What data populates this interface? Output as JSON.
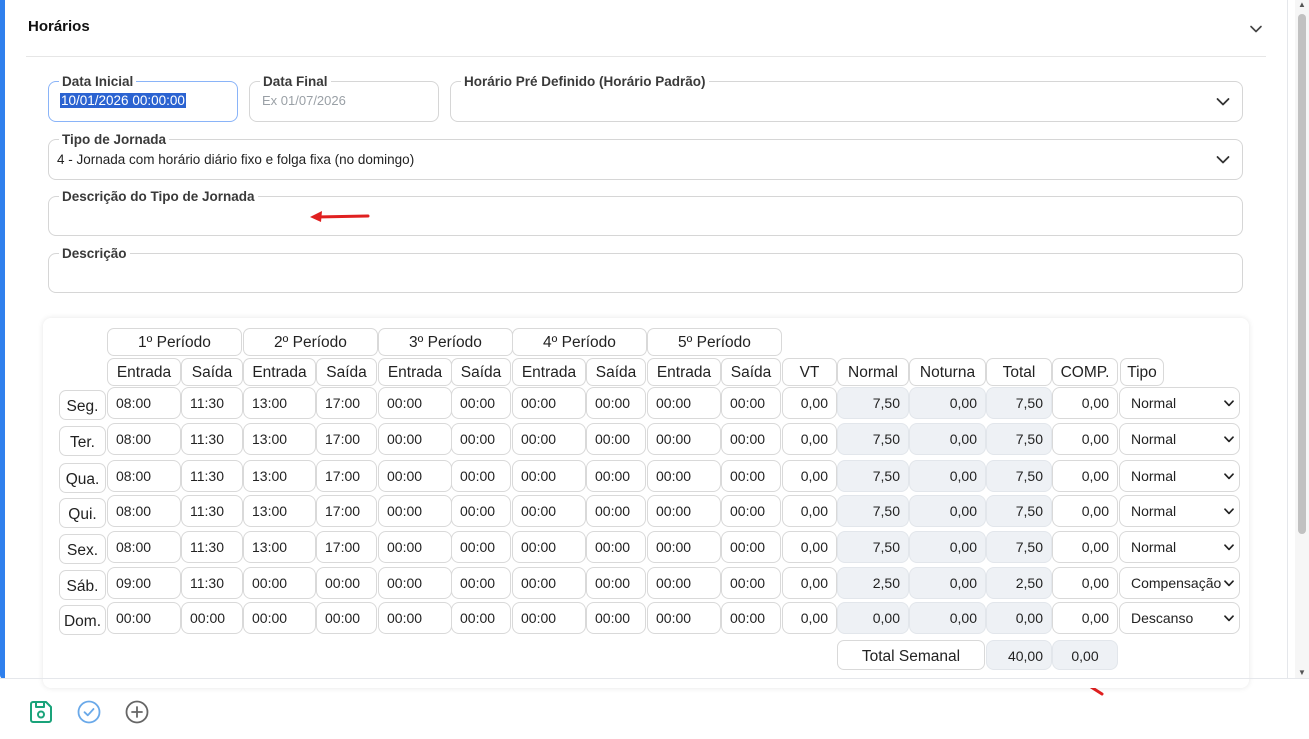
{
  "panel": {
    "title": "Horários"
  },
  "fields": {
    "data_inicial": {
      "label": "Data Inicial",
      "value": "10/01/2026 00:00:00"
    },
    "data_final": {
      "label": "Data Final",
      "placeholder": "Ex 01/07/2026"
    },
    "horario_pre": {
      "label": "Horário Pré Definido (Horário Padrão)",
      "value": ""
    },
    "tipo_jornada": {
      "label": "Tipo de Jornada",
      "value": "4 - Jornada com horário diário fixo e folga fixa (no domingo)"
    },
    "descricao_tipo": {
      "label": "Descrição do Tipo de Jornada",
      "value": ""
    },
    "descricao": {
      "label": "Descrição",
      "value": ""
    }
  },
  "schedule": {
    "periods": [
      "1º Período",
      "2º Período",
      "3º Período",
      "4º Período",
      "5º Período"
    ],
    "entrada_label": "Entrada",
    "saida_label": "Saída",
    "extra_headers": [
      "VT",
      "Normal",
      "Noturna",
      "Total",
      "COMP.",
      "Tipo"
    ],
    "rows": [
      {
        "day": "Seg.",
        "times": [
          "08:00",
          "11:30",
          "13:00",
          "17:00",
          "00:00",
          "00:00",
          "00:00",
          "00:00",
          "00:00",
          "00:00"
        ],
        "vt": "0,00",
        "normal": "7,50",
        "noturna": "0,00",
        "total": "7,50",
        "comp": "0,00",
        "tipo": "Normal"
      },
      {
        "day": "Ter.",
        "times": [
          "08:00",
          "11:30",
          "13:00",
          "17:00",
          "00:00",
          "00:00",
          "00:00",
          "00:00",
          "00:00",
          "00:00"
        ],
        "vt": "0,00",
        "normal": "7,50",
        "noturna": "0,00",
        "total": "7,50",
        "comp": "0,00",
        "tipo": "Normal"
      },
      {
        "day": "Qua.",
        "times": [
          "08:00",
          "11:30",
          "13:00",
          "17:00",
          "00:00",
          "00:00",
          "00:00",
          "00:00",
          "00:00",
          "00:00"
        ],
        "vt": "0,00",
        "normal": "7,50",
        "noturna": "0,00",
        "total": "7,50",
        "comp": "0,00",
        "tipo": "Normal"
      },
      {
        "day": "Qui.",
        "times": [
          "08:00",
          "11:30",
          "13:00",
          "17:00",
          "00:00",
          "00:00",
          "00:00",
          "00:00",
          "00:00",
          "00:00"
        ],
        "vt": "0,00",
        "normal": "7,50",
        "noturna": "0,00",
        "total": "7,50",
        "comp": "0,00",
        "tipo": "Normal"
      },
      {
        "day": "Sex.",
        "times": [
          "08:00",
          "11:30",
          "13:00",
          "17:00",
          "00:00",
          "00:00",
          "00:00",
          "00:00",
          "00:00",
          "00:00"
        ],
        "vt": "0,00",
        "normal": "7,50",
        "noturna": "0,00",
        "total": "7,50",
        "comp": "0,00",
        "tipo": "Normal"
      },
      {
        "day": "Sáb.",
        "times": [
          "09:00",
          "11:30",
          "00:00",
          "00:00",
          "00:00",
          "00:00",
          "00:00",
          "00:00",
          "00:00",
          "00:00"
        ],
        "vt": "0,00",
        "normal": "2,50",
        "noturna": "0,00",
        "total": "2,50",
        "comp": "0,00",
        "tipo": "Compensação"
      },
      {
        "day": "Dom.",
        "times": [
          "00:00",
          "00:00",
          "00:00",
          "00:00",
          "00:00",
          "00:00",
          "00:00",
          "00:00",
          "00:00",
          "00:00"
        ],
        "vt": "0,00",
        "normal": "0,00",
        "noturna": "0,00",
        "total": "0,00",
        "comp": "0,00",
        "tipo": "Descanso"
      }
    ],
    "total_semanal_label": "Total Semanal",
    "total_semanal": "40,00",
    "total_comp": "0,00"
  },
  "colors": {
    "accent": "#2f80ed",
    "annotation_arrow": "#e02020",
    "save_icon": "#1aa37a",
    "confirm_icon": "#6aa9e9"
  },
  "footer": {
    "icons": [
      "save-icon",
      "check-circle-icon",
      "plus-circle-icon"
    ]
  }
}
